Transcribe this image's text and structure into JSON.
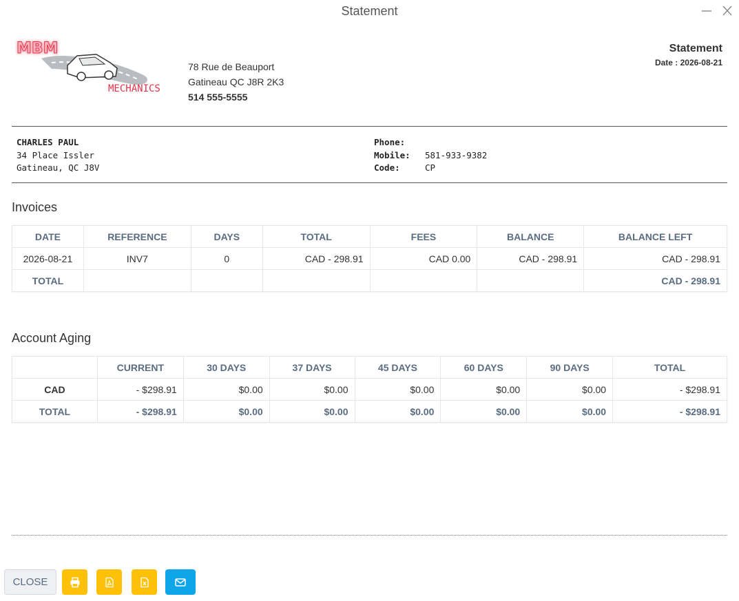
{
  "window": {
    "title": "Statement",
    "minimize_icon": "minimize-icon",
    "close_icon": "close-icon"
  },
  "company": {
    "logo_text": "MBM",
    "logo_sub": "MECHANICS",
    "address_line1": "78 Rue de Beauport",
    "address_line2": "Gatineau QC J8R 2K3",
    "phone": "514 555-5555"
  },
  "document": {
    "title": "Statement",
    "date": "Date : 2026-08-21"
  },
  "client": {
    "name": "CHARLES PAUL",
    "address_line1": "34 Place Issler",
    "address_line2": "Gatineau, QC J8V",
    "phone_label": "Phone:",
    "phone_value": "",
    "mobile_label": "Mobile:",
    "mobile_value": "581-933-9382",
    "code_label": "Code:",
    "code_value": "CP"
  },
  "invoices": {
    "title": "Invoices",
    "headers": [
      "DATE",
      "REFERENCE",
      "DAYS",
      "TOTAL",
      "FEES",
      "BALANCE",
      "BALANCE LEFT"
    ],
    "rows": [
      [
        "2026-08-21",
        "INV7",
        "0",
        "CAD - 298.91",
        "CAD 0.00",
        "CAD - 298.91",
        "CAD - 298.91"
      ]
    ],
    "total_label": "TOTAL",
    "total_balance_left": "CAD - 298.91"
  },
  "aging": {
    "title": "Account Aging",
    "headers": [
      "",
      "CURRENT",
      "30 DAYS",
      "37 DAYS",
      "45 DAYS",
      "60 DAYS",
      "90 DAYS",
      "TOTAL"
    ],
    "rows": [
      [
        "CAD",
        "- $298.91",
        "$0.00",
        "$0.00",
        "$0.00",
        "$0.00",
        "$0.00",
        "- $298.91"
      ]
    ],
    "total_row": [
      "TOTAL",
      "- $298.91",
      "$0.00",
      "$0.00",
      "$0.00",
      "$0.00",
      "$0.00",
      "- $298.91"
    ]
  },
  "buttons": {
    "close_label": "CLOSE",
    "print_icon": "print-icon",
    "pdf_icon": "pdf-icon",
    "excel_icon": "excel-icon",
    "email_icon": "email-icon",
    "yellow_color": "#ffc107",
    "blue_color": "#0ea5e9"
  },
  "colors": {
    "header_text": "#5a6c81",
    "logo_red": "#e8304a"
  }
}
